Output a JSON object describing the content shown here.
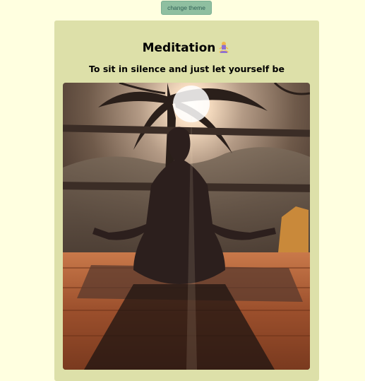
{
  "theme_button": {
    "label": "change theme"
  },
  "card": {
    "title": "Meditation",
    "title_icon": "person-in-lotus-position-emoji",
    "subtitle": "To sit in silence and just let yourself be"
  },
  "image": {
    "subject": "meditation-silhouette-photo"
  }
}
